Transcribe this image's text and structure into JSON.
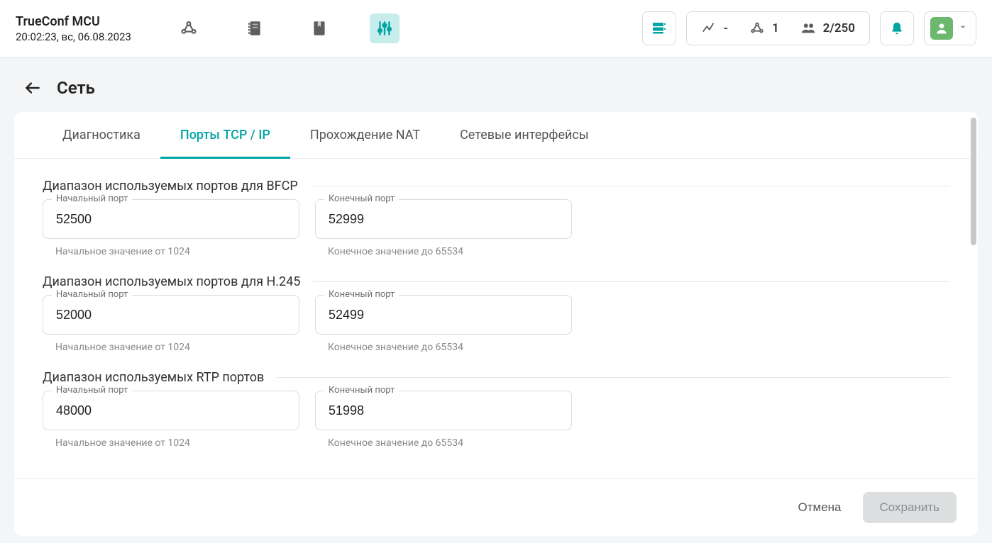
{
  "brand": {
    "title": "TrueConf MCU",
    "datetime": "20:02:23, вс, 06.08.2023"
  },
  "stats": {
    "activity": "-",
    "conferences": "1",
    "participants": "2/250"
  },
  "page": {
    "title": "Сеть"
  },
  "tabs": {
    "diagnostics": "Диагностика",
    "ports": "Порты TCP / IP",
    "nat": "Прохождение NAT",
    "interfaces": "Сетевые интерфейсы"
  },
  "labels": {
    "start": "Начальный порт",
    "end": "Конечный порт"
  },
  "hints": {
    "start": "Начальное значение от 1024",
    "end": "Конечное значение до 65534"
  },
  "groups": {
    "bfcp": {
      "title": "Диапазон используемых портов для BFCP",
      "start": "52500",
      "end": "52999"
    },
    "h245": {
      "title": "Диапазон используемых портов для H.245",
      "start": "52000",
      "end": "52499"
    },
    "rtp": {
      "title": "Диапазон используемых RTP портов",
      "start": "48000",
      "end": "51998"
    }
  },
  "footer": {
    "cancel": "Отмена",
    "save": "Сохранить"
  }
}
